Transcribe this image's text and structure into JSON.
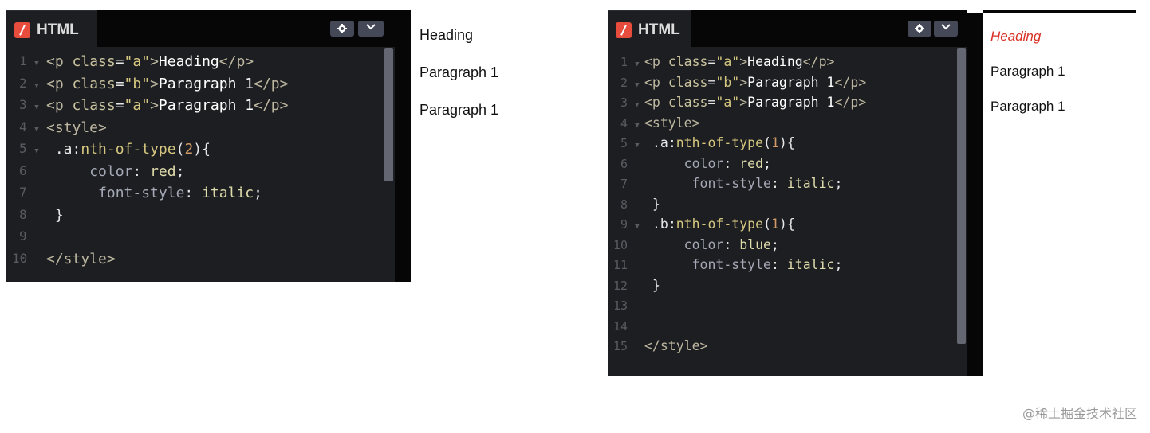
{
  "left": {
    "tab_label": "HTML",
    "code_lines": [
      {
        "n": "1",
        "fold": true
      },
      {
        "n": "2",
        "fold": true
      },
      {
        "n": "3",
        "fold": true
      },
      {
        "n": "4",
        "fold": true
      },
      {
        "n": "5",
        "fold": true
      },
      {
        "n": "6",
        "fold": false
      },
      {
        "n": "7",
        "fold": false
      },
      {
        "n": "8",
        "fold": false
      },
      {
        "n": "9",
        "fold": false
      },
      {
        "n": "10",
        "fold": false
      }
    ],
    "tokens": {
      "l1_text": "Heading",
      "l2_text": "Paragraph 1",
      "l3_text": "Paragraph 1",
      "l5_sel": ".a",
      "l5_pseudo": "nth-of-type",
      "l5_num": "2",
      "l6_prop": "color",
      "l6_val": "red",
      "l7_prop": "font-style",
      "l7_val": "italic"
    },
    "preview": [
      "Heading",
      "Paragraph 1",
      "Paragraph 1"
    ]
  },
  "right": {
    "tab_label": "HTML",
    "code_lines": [
      {
        "n": "1",
        "fold": true
      },
      {
        "n": "2",
        "fold": true
      },
      {
        "n": "3",
        "fold": true
      },
      {
        "n": "4",
        "fold": true
      },
      {
        "n": "5",
        "fold": true
      },
      {
        "n": "6",
        "fold": false
      },
      {
        "n": "7",
        "fold": false
      },
      {
        "n": "8",
        "fold": false
      },
      {
        "n": "9",
        "fold": true
      },
      {
        "n": "10",
        "fold": false
      },
      {
        "n": "11",
        "fold": false
      },
      {
        "n": "12",
        "fold": false
      },
      {
        "n": "13",
        "fold": false
      },
      {
        "n": "14",
        "fold": false
      },
      {
        "n": "15",
        "fold": false
      }
    ],
    "tokens": {
      "l1_text": "Heading",
      "l2_text": "Paragraph 1",
      "l3_text": "Paragraph 1",
      "l5_sel": ".a",
      "l5_pseudo": "nth-of-type",
      "l5_num": "1",
      "l6_prop": "color",
      "l6_val": "red",
      "l7_prop": "font-style",
      "l7_val": "italic",
      "l9_sel": ".b",
      "l9_pseudo": "nth-of-type",
      "l9_num": "1",
      "l10_prop": "color",
      "l10_val": "blue",
      "l11_prop": "font-style",
      "l11_val": "italic"
    },
    "preview": [
      "Heading",
      "Paragraph 1",
      "Paragraph 1"
    ]
  },
  "watermark": "@稀土掘金技术社区",
  "icons": {
    "settings": "gear-icon",
    "expand": "chevron-down-icon",
    "logo": "codepen-logo-icon"
  },
  "colors": {
    "editor_bg": "#1d1e22",
    "logo": "#e74c3c",
    "preview_red": "#d93025"
  }
}
